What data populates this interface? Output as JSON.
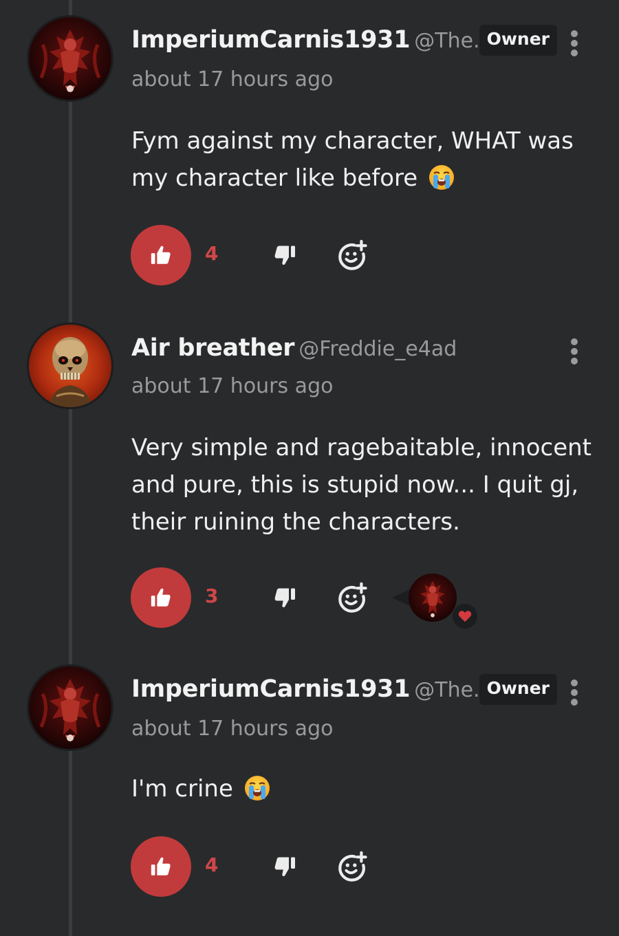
{
  "comments": [
    {
      "author": "ImperiumCarnis1931",
      "handle": "@The...",
      "badge": "Owner",
      "time": "about 17 hours ago",
      "text": "Fym against my character, WHAT was my character like before",
      "emoji": "loudly-crying-face",
      "likes": "4",
      "avatar_icon": "demonic-figure-avatar"
    },
    {
      "author": "Air breather",
      "handle": "@Freddie_e4ad",
      "badge": "",
      "time": "about 17 hours ago",
      "text": "Very simple and ragebaitable, innocent and pure, this is stupid now... I quit gj, their ruining the characters.",
      "emoji": "",
      "likes": "3",
      "avatar_icon": "skull-avatar",
      "reaction": {
        "icon": "heart-icon",
        "color": "#c23b3c"
      }
    },
    {
      "author": "ImperiumCarnis1931",
      "handle": "@The...",
      "badge": "Owner",
      "time": "about 17 hours ago",
      "text": "I'm crine",
      "emoji": "loudly-crying-face",
      "likes": "4",
      "avatar_icon": "demonic-figure-avatar"
    }
  ],
  "colors": {
    "background": "#292a2c",
    "accent": "#c23b3c",
    "muted_text": "#9a9a9a",
    "badge_bg": "#1d1e20"
  }
}
